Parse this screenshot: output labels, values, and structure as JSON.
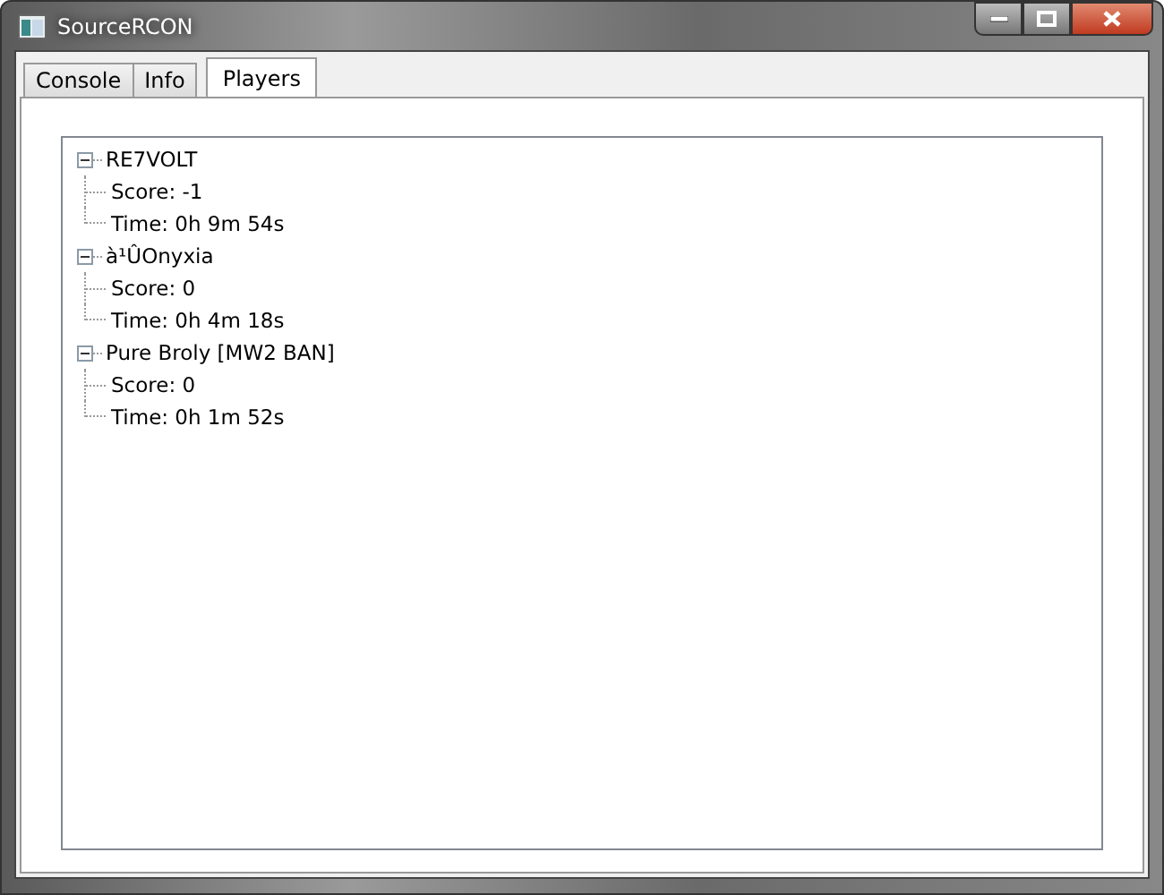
{
  "window": {
    "title": "SourceRCON"
  },
  "tabs": [
    {
      "label": "Console",
      "selected": false
    },
    {
      "label": "Info",
      "selected": false
    },
    {
      "label": "Players",
      "selected": true
    }
  ],
  "tree": [
    {
      "label": "RE7VOLT",
      "expanded": true,
      "children": [
        {
          "label": "Score: -1"
        },
        {
          "label": "Time: 0h 9m 54s"
        }
      ]
    },
    {
      "label": "à¹ÛOnyxia",
      "expanded": true,
      "children": [
        {
          "label": "Score: 0"
        },
        {
          "label": "Time: 0h 4m 18s"
        }
      ]
    },
    {
      "label": "Pure Broly [MW2 BAN]",
      "expanded": true,
      "children": [
        {
          "label": "Score: 0"
        },
        {
          "label": "Time: 0h 1m 52s"
        }
      ]
    }
  ]
}
